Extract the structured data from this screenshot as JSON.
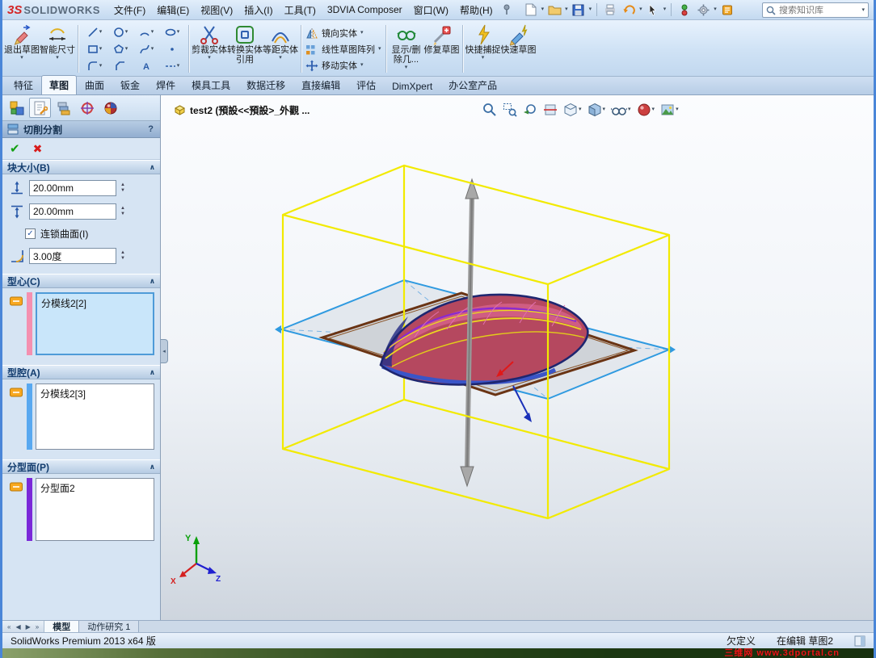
{
  "colors": {
    "window_frame": "#4a86d8",
    "box_wireframe_yellow": "#f2ea00",
    "plane_outline_blue": "#2f9ae0",
    "part_body_red": "#b5485f",
    "core_bar_pink": "#f490b0",
    "cavity_bar_blue": "#58a8f0",
    "parting_bar_purple": "#7a28d8",
    "watermark_text_red": "#e81818"
  },
  "ui": {
    "caret": "▾",
    "chevron": "∧",
    "spin_up": "▲",
    "spin_down": "▼",
    "check": "✓",
    "collapse_left": "◂",
    "nav": [
      "«",
      "◀",
      "▶",
      "»"
    ]
  },
  "titlebar": {
    "logo_mark": "3S",
    "logo_text": "SOLIDWORKS",
    "menus": [
      "文件(F)",
      "编辑(E)",
      "视图(V)",
      "插入(I)",
      "工具(T)",
      "3DVIA Composer",
      "窗口(W)",
      "帮助(H)"
    ],
    "quick_icon_names": [
      "new-document",
      "open",
      "save",
      "print",
      "undo",
      "select",
      "rebuild",
      "options",
      "help-resources"
    ],
    "search_placeholder": "搜索知识库"
  },
  "ribbon": {
    "large_buttons": [
      {
        "label": "退出草图"
      },
      {
        "label": "智能尺寸"
      },
      {
        "label": "剪裁实体"
      },
      {
        "label": "转换实体引用"
      },
      {
        "label": "等距实体"
      },
      {
        "label": "显示/删除几..."
      },
      {
        "label": "修复草图"
      },
      {
        "label": "快捷捕捉"
      },
      {
        "label": "快速草图"
      }
    ],
    "small_buttons": [
      {
        "label": "镜向实体"
      },
      {
        "label": "线性草图阵列"
      },
      {
        "label": "移动实体"
      }
    ],
    "sketch_grid_icon_names": [
      "line",
      "circle",
      "arc",
      "ellipse",
      "rectangle",
      "polygon",
      "spline",
      "point",
      "fillet",
      "chamfer",
      "text",
      "centerline"
    ]
  },
  "command_tabs": [
    {
      "label": "特征"
    },
    {
      "label": "草图"
    },
    {
      "label": "曲面"
    },
    {
      "label": "钣金"
    },
    {
      "label": "焊件"
    },
    {
      "label": "模具工具"
    },
    {
      "label": "数据迁移"
    },
    {
      "label": "直接编辑"
    },
    {
      "label": "评估"
    },
    {
      "label": "DimXpert"
    },
    {
      "label": "办公室产品"
    }
  ],
  "manager_tab_icon_names": [
    "featuremanager",
    "propertymanager",
    "configurationmanager",
    "dimxpertmanager",
    "appearances"
  ],
  "property_manager": {
    "title": "切削分割",
    "help": "?",
    "ok": "✔",
    "cancel": "✖",
    "block_size": {
      "header": "块大小(B)",
      "depth1": "20.00mm",
      "depth2": "20.00mm",
      "interlock_label": "连锁曲面(I)",
      "interlock_checked": true,
      "draft_angle": "3.00度"
    },
    "core": {
      "header": "型心(C)",
      "item": "分模线2[2]"
    },
    "cavity": {
      "header": "型腔(A)",
      "item": "分模线2[3]"
    },
    "parting_surface": {
      "header": "分型面(P)",
      "item": "分型面2"
    }
  },
  "viewport": {
    "document_label": "test2 (預設<<預設>_外觀 ...",
    "heads_up_icon_names": [
      "zoom-fit",
      "zoom-area",
      "previous-view",
      "section-view",
      "view-orientation",
      "display-style",
      "hide-show-items",
      "edit-appearance",
      "apply-scene"
    ],
    "triad": {
      "x": "X",
      "y": "Y",
      "z": "Z"
    }
  },
  "bottom_bar": {
    "tabs": [
      {
        "label": "模型"
      },
      {
        "label": "动作研究 1"
      }
    ]
  },
  "status_bar": {
    "product": "SolidWorks Premium 2013 x64 版",
    "state": "欠定义",
    "editing": "在编辑 草图2"
  },
  "watermark": "三维网 www.3dportal.cn"
}
